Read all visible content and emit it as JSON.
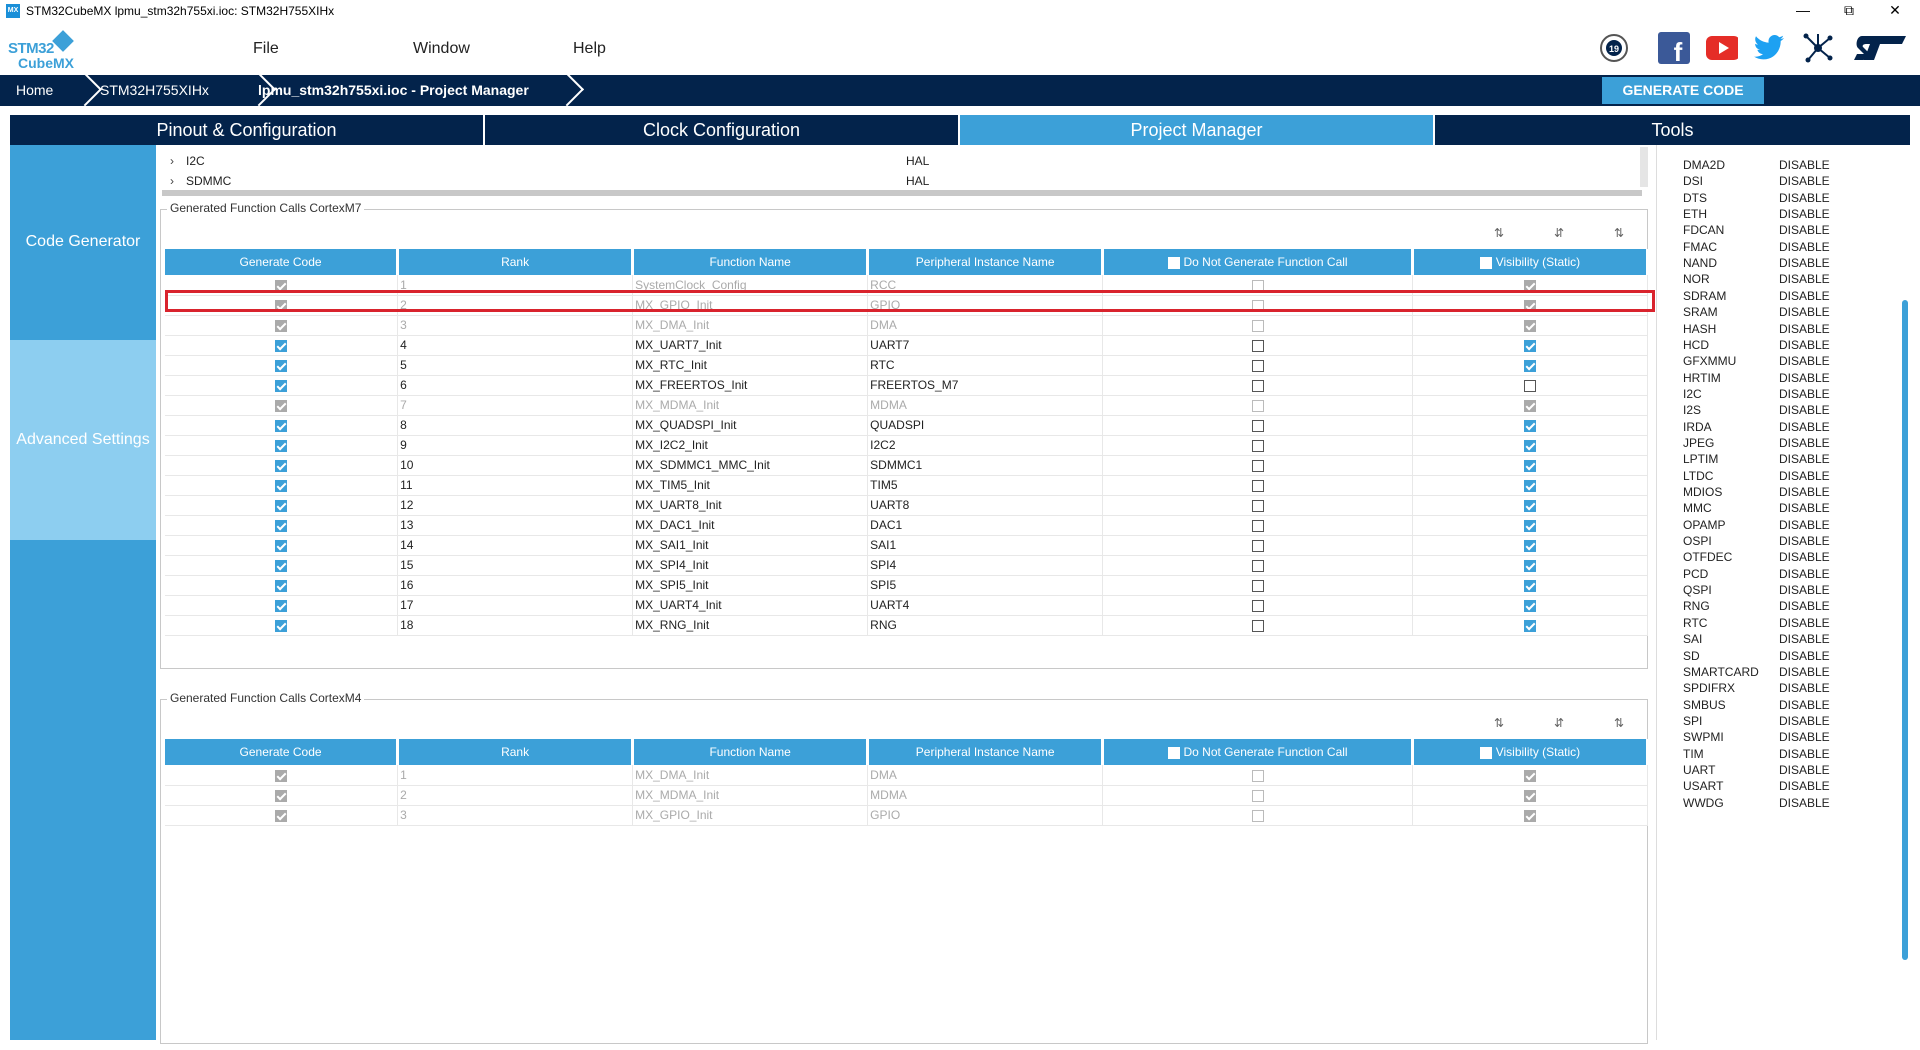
{
  "window": {
    "title": "STM32CubeMX lpmu_stm32h755xi.ioc: STM32H755XIHx",
    "app_icon": "MX"
  },
  "logo": {
    "line1": "STM32",
    "line2": "CubeMX"
  },
  "menu": [
    "File",
    "Window",
    "Help"
  ],
  "social": [
    "anniversary-icon",
    "facebook-icon",
    "youtube-icon",
    "twitter-icon",
    "network-icon",
    "st-logo-icon"
  ],
  "breadcrumb": [
    "Home",
    "STM32H755XIHx",
    "lpmu_stm32h755xi.ioc - Project Manager"
  ],
  "generate_button": "GENERATE CODE",
  "tabs": [
    "Pinout & Configuration",
    "Clock Configuration",
    "Project Manager",
    "Tools"
  ],
  "leftnav": [
    "Code Generator",
    "Advanced Settings"
  ],
  "top_modules": [
    {
      "name": "I2C",
      "driver": "HAL"
    },
    {
      "name": "SDMMC",
      "driver": "HAL"
    }
  ],
  "headers": {
    "generate_code": "Generate Code",
    "rank": "Rank",
    "function_name": "Function Name",
    "peripheral": "Peripheral Instance Name",
    "no_call": "Do Not Generate Function Call",
    "visibility": "Visibility (Static)"
  },
  "group_m7": {
    "title": "Generated Function Calls CortexM7",
    "rows": [
      {
        "rank": "1",
        "fn": "SystemClock_Config",
        "periph": "RCC",
        "disabled": true,
        "gen": true,
        "nocall": false,
        "vis": true
      },
      {
        "rank": "2",
        "fn": "MX_GPIO_Init",
        "periph": "GPIO",
        "disabled": true,
        "gen": true,
        "nocall": false,
        "vis": true
      },
      {
        "rank": "3",
        "fn": "MX_DMA_Init",
        "periph": "DMA",
        "disabled": true,
        "gen": true,
        "nocall": false,
        "vis": true
      },
      {
        "rank": "4",
        "fn": "MX_UART7_Init",
        "periph": "UART7",
        "disabled": false,
        "gen": true,
        "nocall": false,
        "vis": true
      },
      {
        "rank": "5",
        "fn": "MX_RTC_Init",
        "periph": "RTC",
        "disabled": false,
        "gen": true,
        "nocall": false,
        "vis": true
      },
      {
        "rank": "6",
        "fn": "MX_FREERTOS_Init",
        "periph": "FREERTOS_M7",
        "disabled": false,
        "gen": true,
        "nocall": false,
        "vis": false
      },
      {
        "rank": "7",
        "fn": "MX_MDMA_Init",
        "periph": "MDMA",
        "disabled": true,
        "gen": true,
        "nocall": false,
        "vis": true
      },
      {
        "rank": "8",
        "fn": "MX_QUADSPI_Init",
        "periph": "QUADSPI",
        "disabled": false,
        "gen": true,
        "nocall": false,
        "vis": true
      },
      {
        "rank": "9",
        "fn": "MX_I2C2_Init",
        "periph": "I2C2",
        "disabled": false,
        "gen": true,
        "nocall": false,
        "vis": true
      },
      {
        "rank": "10",
        "fn": "MX_SDMMC1_MMC_Init",
        "periph": "SDMMC1",
        "disabled": false,
        "gen": true,
        "nocall": false,
        "vis": true
      },
      {
        "rank": "11",
        "fn": "MX_TIM5_Init",
        "periph": "TIM5",
        "disabled": false,
        "gen": true,
        "nocall": false,
        "vis": true
      },
      {
        "rank": "12",
        "fn": "MX_UART8_Init",
        "periph": "UART8",
        "disabled": false,
        "gen": true,
        "nocall": false,
        "vis": true
      },
      {
        "rank": "13",
        "fn": "MX_DAC1_Init",
        "periph": "DAC1",
        "disabled": false,
        "gen": true,
        "nocall": false,
        "vis": true
      },
      {
        "rank": "14",
        "fn": "MX_SAI1_Init",
        "periph": "SAI1",
        "disabled": false,
        "gen": true,
        "nocall": false,
        "vis": true
      },
      {
        "rank": "15",
        "fn": "MX_SPI4_Init",
        "periph": "SPI4",
        "disabled": false,
        "gen": true,
        "nocall": false,
        "vis": true
      },
      {
        "rank": "16",
        "fn": "MX_SPI5_Init",
        "periph": "SPI5",
        "disabled": false,
        "gen": true,
        "nocall": false,
        "vis": true
      },
      {
        "rank": "17",
        "fn": "MX_UART4_Init",
        "periph": "UART4",
        "disabled": false,
        "gen": true,
        "nocall": false,
        "vis": true
      },
      {
        "rank": "18",
        "fn": "MX_RNG_Init",
        "periph": "RNG",
        "disabled": false,
        "gen": true,
        "nocall": false,
        "vis": true
      }
    ]
  },
  "group_m4": {
    "title": "Generated Function Calls CortexM4",
    "rows": [
      {
        "rank": "1",
        "fn": "MX_DMA_Init",
        "periph": "DMA",
        "disabled": true,
        "gen": true,
        "nocall": false,
        "vis": true
      },
      {
        "rank": "2",
        "fn": "MX_MDMA_Init",
        "periph": "MDMA",
        "disabled": true,
        "gen": true,
        "nocall": false,
        "vis": true
      },
      {
        "rank": "3",
        "fn": "MX_GPIO_Init",
        "periph": "GPIO",
        "disabled": true,
        "gen": true,
        "nocall": false,
        "vis": true
      }
    ]
  },
  "right_list": [
    [
      "DMA2D",
      "DISABLE"
    ],
    [
      "DSI",
      "DISABLE"
    ],
    [
      "DTS",
      "DISABLE"
    ],
    [
      "ETH",
      "DISABLE"
    ],
    [
      "FDCAN",
      "DISABLE"
    ],
    [
      "FMAC",
      "DISABLE"
    ],
    [
      "NAND",
      "DISABLE"
    ],
    [
      "NOR",
      "DISABLE"
    ],
    [
      "SDRAM",
      "DISABLE"
    ],
    [
      "SRAM",
      "DISABLE"
    ],
    [
      "HASH",
      "DISABLE"
    ],
    [
      "HCD",
      "DISABLE"
    ],
    [
      "GFXMMU",
      "DISABLE"
    ],
    [
      "HRTIM",
      "DISABLE"
    ],
    [
      "I2C",
      "DISABLE"
    ],
    [
      "I2S",
      "DISABLE"
    ],
    [
      "IRDA",
      "DISABLE"
    ],
    [
      "JPEG",
      "DISABLE"
    ],
    [
      "LPTIM",
      "DISABLE"
    ],
    [
      "LTDC",
      "DISABLE"
    ],
    [
      "MDIOS",
      "DISABLE"
    ],
    [
      "MMC",
      "DISABLE"
    ],
    [
      "OPAMP",
      "DISABLE"
    ],
    [
      "OSPI",
      "DISABLE"
    ],
    [
      "OTFDEC",
      "DISABLE"
    ],
    [
      "PCD",
      "DISABLE"
    ],
    [
      "QSPI",
      "DISABLE"
    ],
    [
      "RNG",
      "DISABLE"
    ],
    [
      "RTC",
      "DISABLE"
    ],
    [
      "SAI",
      "DISABLE"
    ],
    [
      "SD",
      "DISABLE"
    ],
    [
      "SMARTCARD",
      "DISABLE"
    ],
    [
      "SPDIFRX",
      "DISABLE"
    ],
    [
      "SMBUS",
      "DISABLE"
    ],
    [
      "SPI",
      "DISABLE"
    ],
    [
      "SWPMI",
      "DISABLE"
    ],
    [
      "TIM",
      "DISABLE"
    ],
    [
      "UART",
      "DISABLE"
    ],
    [
      "USART",
      "DISABLE"
    ],
    [
      "WWDG",
      "DISABLE"
    ]
  ],
  "colors": {
    "accent": "#3ca0d8",
    "navy": "#03234b",
    "highlight": "#d9232d"
  }
}
